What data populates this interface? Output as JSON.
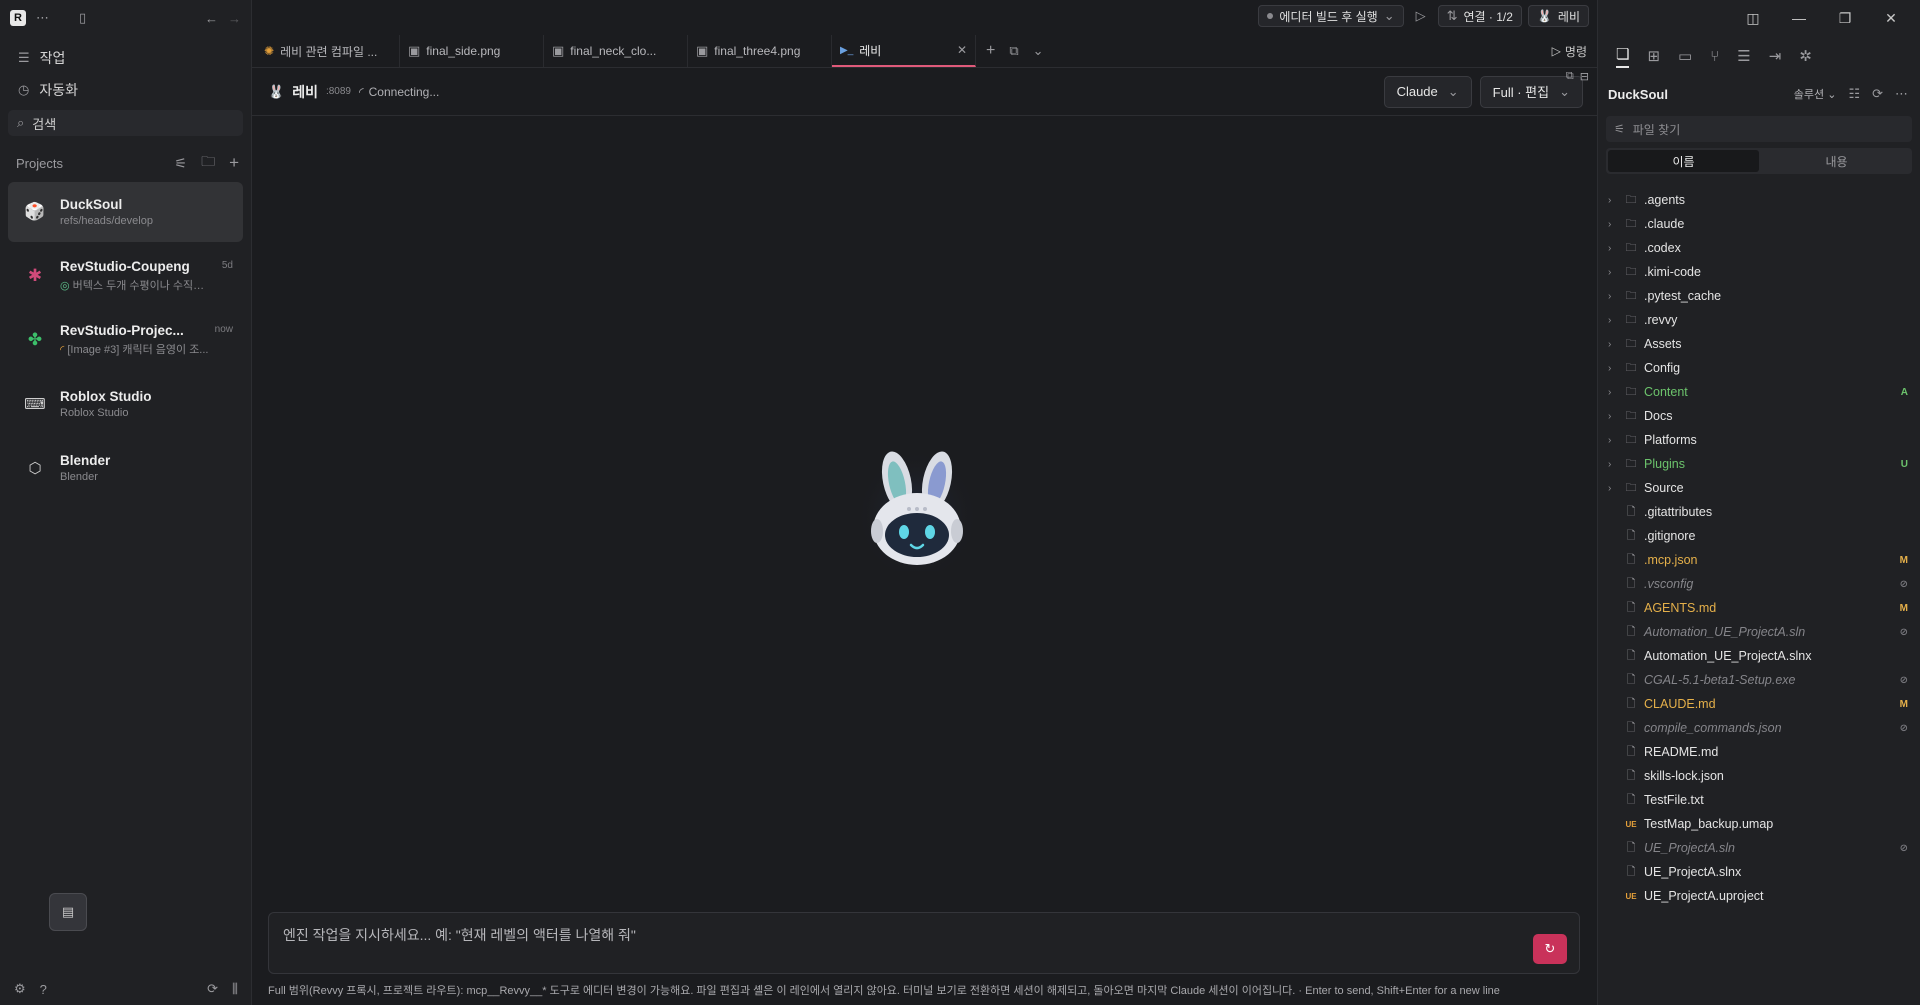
{
  "sidebar": {
    "nav": [
      {
        "label": "작업",
        "icon": "list-icon"
      },
      {
        "label": "자동화",
        "icon": "clock-icon"
      }
    ],
    "search_label": "검색",
    "projects_header": "Projects",
    "projects": [
      {
        "name": "DuckSoul",
        "sub": "refs/heads/develop",
        "time": "",
        "icon": "die-icon",
        "active": true
      },
      {
        "name": "RevStudio-Coupeng",
        "sub": "버텍스 두개 수평이나 수직으...",
        "time": "5d",
        "icon": "bug-icon",
        "active": false
      },
      {
        "name": "RevStudio-Projec...",
        "sub": "[Image #3] 캐릭터 음영이 조...",
        "time": "now",
        "icon": "clover-icon",
        "active": false
      },
      {
        "name": "Roblox Studio",
        "sub": "Roblox Studio",
        "time": "",
        "icon": "gamepad-icon",
        "active": false
      },
      {
        "name": "Blender",
        "sub": "Blender",
        "time": "",
        "icon": "cube-icon",
        "active": false
      }
    ]
  },
  "topbar": {
    "run_label": "에디터 빌드 후 실행",
    "connection_label": "연결 · 1/2",
    "user_label": "레비"
  },
  "tabs": [
    {
      "label": "레비 관련 컴파일 ..."
    },
    {
      "label": "final_side.png"
    },
    {
      "label": "final_neck_clo..."
    },
    {
      "label": "final_three4.png"
    },
    {
      "label": "레비",
      "active": true
    }
  ],
  "command_label": "명령",
  "chat": {
    "title": "레비",
    "port": ":8089",
    "status": "Connecting...",
    "model": "Claude",
    "mode": "Full · 편집",
    "placeholder": "엔진 작업을 지시하세요... 예: \"현재 레벨의 액터를 나열해 줘\"",
    "hint": "Full 범위(Revvy 프록시, 프로젝트 라우트): mcp__Revvy__* 도구로 에디터 변경이 가능해요. 파일 편집과 셸은 이 레인에서 열리지 않아요. 터미널 보기로 전환하면 세션이 해제되고, 돌아오면 마지막 Claude 세션이 이어집니다. · Enter to send, Shift+Enter for a new line"
  },
  "explorer": {
    "workspace": "DuckSoul",
    "solution_label": "솔루션",
    "search_placeholder": "파일 찾기",
    "seg_name": "이름",
    "seg_content": "내용",
    "items": [
      {
        "name": ".agents",
        "type": "folder",
        "status": ""
      },
      {
        "name": ".claude",
        "type": "folder",
        "status": ""
      },
      {
        "name": ".codex",
        "type": "folder",
        "status": ""
      },
      {
        "name": ".kimi-code",
        "type": "folder",
        "status": ""
      },
      {
        "name": ".pytest_cache",
        "type": "folder",
        "status": ""
      },
      {
        "name": ".revvy",
        "type": "folder",
        "status": ""
      },
      {
        "name": "Assets",
        "type": "folder",
        "status": ""
      },
      {
        "name": "Config",
        "type": "folder",
        "status": ""
      },
      {
        "name": "Content",
        "type": "folder",
        "status": "A"
      },
      {
        "name": "Docs",
        "type": "folder",
        "status": ""
      },
      {
        "name": "Platforms",
        "type": "folder",
        "status": ""
      },
      {
        "name": "Plugins",
        "type": "folder",
        "status": "U"
      },
      {
        "name": "Source",
        "type": "folder",
        "status": ""
      },
      {
        "name": ".gitattributes",
        "type": "file",
        "status": ""
      },
      {
        "name": ".gitignore",
        "type": "file",
        "status": ""
      },
      {
        "name": ".mcp.json",
        "type": "file",
        "status": "M"
      },
      {
        "name": ".vsconfig",
        "type": "file",
        "status": "ignored"
      },
      {
        "name": "AGENTS.md",
        "type": "file",
        "status": "M"
      },
      {
        "name": "Automation_UE_ProjectA.sln",
        "type": "file",
        "status": "ignored"
      },
      {
        "name": "Automation_UE_ProjectA.slnx",
        "type": "file",
        "status": ""
      },
      {
        "name": "CGAL-5.1-beta1-Setup.exe",
        "type": "file",
        "status": "ignored"
      },
      {
        "name": "CLAUDE.md",
        "type": "file",
        "status": "M"
      },
      {
        "name": "compile_commands.json",
        "type": "file",
        "status": "ignored"
      },
      {
        "name": "README.md",
        "type": "file",
        "status": ""
      },
      {
        "name": "skills-lock.json",
        "type": "file",
        "status": ""
      },
      {
        "name": "TestFile.txt",
        "type": "file",
        "status": ""
      },
      {
        "name": "TestMap_backup.umap",
        "type": "ue",
        "status": ""
      },
      {
        "name": "UE_ProjectA.sln",
        "type": "file",
        "status": "ignored"
      },
      {
        "name": "UE_ProjectA.slnx",
        "type": "file",
        "status": ""
      },
      {
        "name": "UE_ProjectA.uproject",
        "type": "ue",
        "status": ""
      }
    ]
  },
  "colors": {
    "accent": "#e05a7a",
    "send": "#c9325a",
    "modified": "#e5b04a",
    "added": "#6cc36c"
  }
}
